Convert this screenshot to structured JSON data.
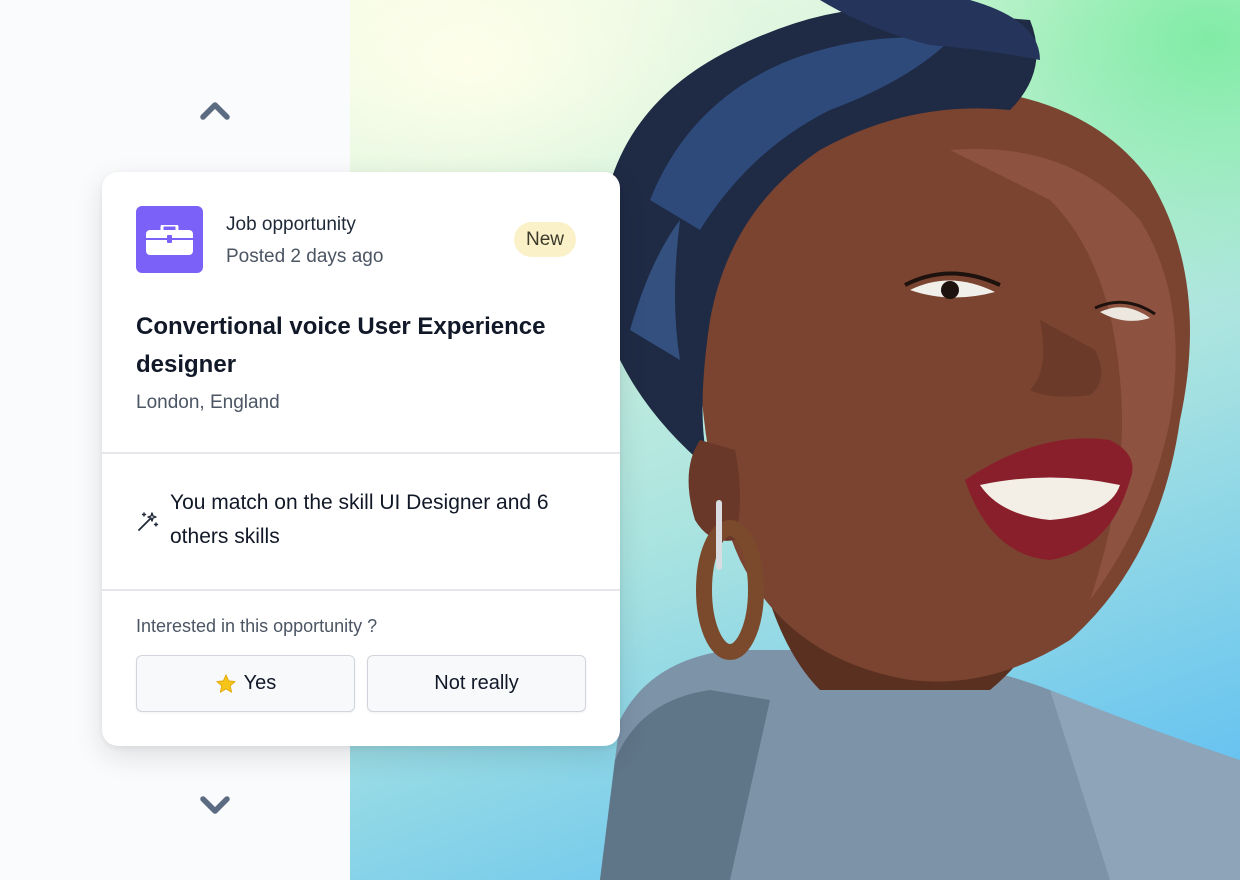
{
  "card": {
    "type_label": "Job opportunity",
    "posted": "Posted 2 days ago",
    "badge": "New",
    "title": "Convertional voice User Experience designer",
    "location": "London, England",
    "match_text": "You match on the skill UI Designer and 6 others skills",
    "question": "Interested in this opportunity ?",
    "yes_label": "Yes",
    "no_label": "Not really"
  },
  "colors": {
    "icon_background": "#7b61f8",
    "badge_background": "#fbf1c9",
    "arrow": "#5b6b82",
    "star": "#f5c518"
  },
  "icons": {
    "nav_up": "chevron-up-icon",
    "nav_down": "chevron-down-icon",
    "job": "briefcase-icon",
    "match": "magic-wand-icon",
    "yes": "star-icon"
  }
}
